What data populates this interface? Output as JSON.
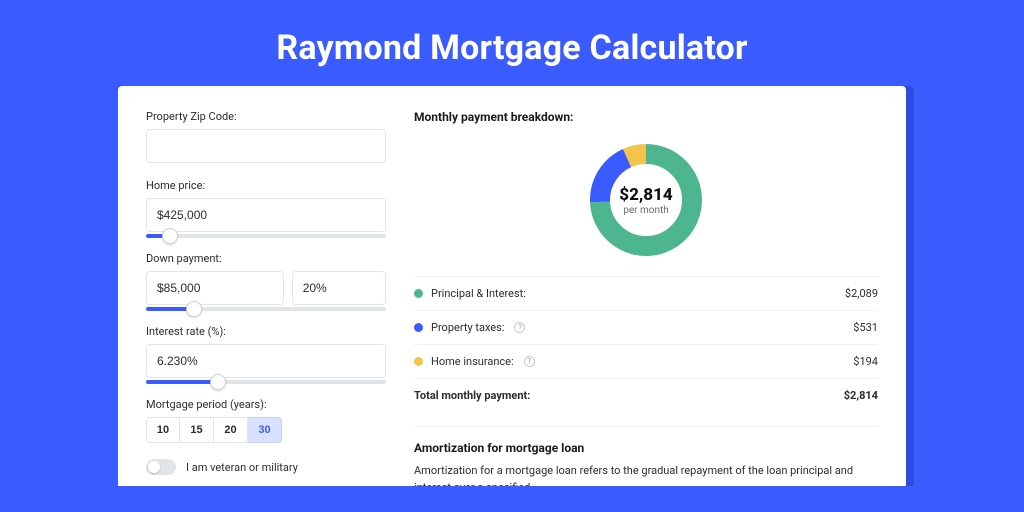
{
  "page": {
    "title": "Raymond Mortgage Calculator"
  },
  "form": {
    "zip": {
      "label": "Property Zip Code:",
      "value": ""
    },
    "homePrice": {
      "label": "Home price:",
      "value": "$425,000",
      "sliderPercent": 10
    },
    "downPayment": {
      "label": "Down payment:",
      "amount": "$85,000",
      "percent": "20%",
      "sliderPercent": 20
    },
    "interest": {
      "label": "Interest rate (%):",
      "value": "6.230%",
      "sliderPercent": 30
    },
    "period": {
      "label": "Mortgage period (years):",
      "options": [
        "10",
        "15",
        "20",
        "30"
      ],
      "selected": "30"
    },
    "veteran": {
      "label": "I am veteran or military",
      "checked": false
    }
  },
  "breakdown": {
    "title": "Monthly payment breakdown:",
    "centerAmount": "$2,814",
    "centerSub": "per month",
    "items": [
      {
        "label": "Principal & Interest:",
        "value": "$2,089",
        "color": "#4DB68F",
        "info": false,
        "share": 74.2
      },
      {
        "label": "Property taxes:",
        "value": "$531",
        "color": "#3A5CFF",
        "info": true,
        "share": 18.9
      },
      {
        "label": "Home insurance:",
        "value": "$194",
        "color": "#F3C44B",
        "info": true,
        "share": 6.9
      }
    ],
    "totalLabel": "Total monthly payment:",
    "totalValue": "$2,814"
  },
  "amortization": {
    "title": "Amortization for mortgage loan",
    "text": "Amortization for a mortgage loan refers to the gradual repayment of the loan principal and interest over a specified"
  },
  "chart_data": {
    "type": "pie",
    "title": "Monthly payment breakdown",
    "series": [
      {
        "name": "Principal & Interest",
        "value": 2089,
        "color": "#4DB68F"
      },
      {
        "name": "Property taxes",
        "value": 531,
        "color": "#3A5CFF"
      },
      {
        "name": "Home insurance",
        "value": 194,
        "color": "#F3C44B"
      }
    ],
    "total": 2814,
    "unit": "USD per month"
  }
}
